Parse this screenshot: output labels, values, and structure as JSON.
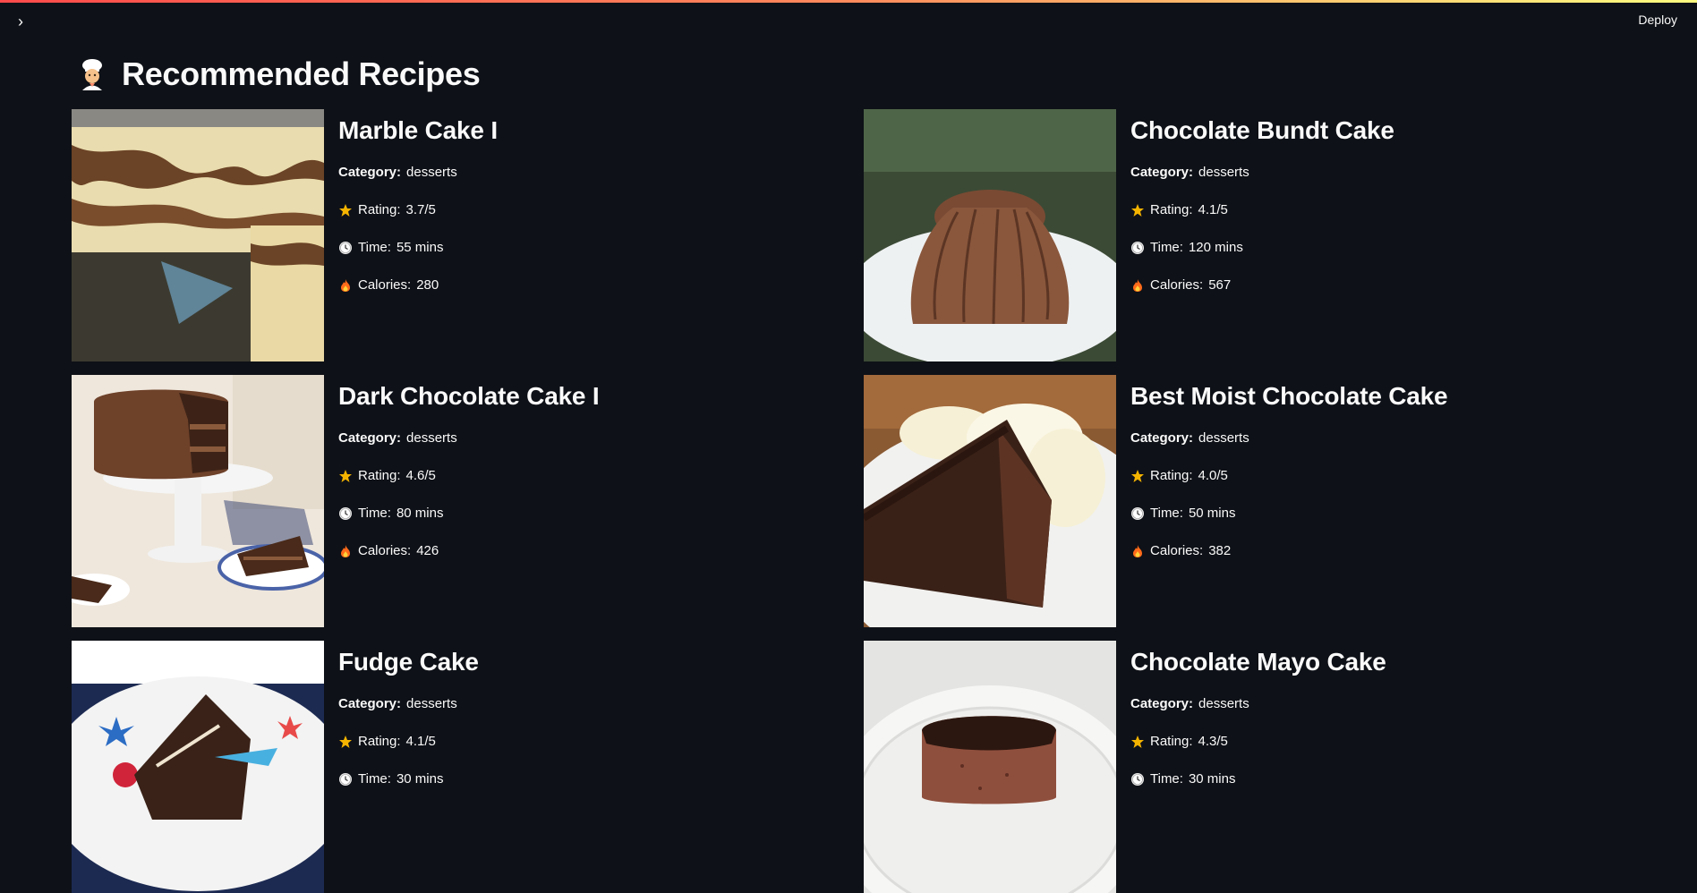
{
  "header": {
    "deploy_label": "Deploy",
    "sidebar_toggle_glyph": "›"
  },
  "page": {
    "title": "Recommended Recipes",
    "title_icon": "chef-icon"
  },
  "labels": {
    "category": "Category:",
    "rating_prefix": "Rating:",
    "time_prefix": "Time:",
    "calories_prefix": "Calories:"
  },
  "icons": {
    "rating": "star-icon",
    "time": "clock-icon",
    "calories": "fire-icon"
  },
  "colors": {
    "background": "#0e1117",
    "text": "#fafafa",
    "star": "#f5b400",
    "flame": "#ff6a1a"
  },
  "recipes": [
    {
      "title": "Marble Cake I",
      "category": "desserts",
      "rating": "3.7/5",
      "time": "55 mins",
      "calories": "280",
      "image": "marble-cake-photo"
    },
    {
      "title": "Chocolate Bundt Cake",
      "category": "desserts",
      "rating": "4.1/5",
      "time": "120 mins",
      "calories": "567",
      "image": "bundt-cake-photo"
    },
    {
      "title": "Dark Chocolate Cake I",
      "category": "desserts",
      "rating": "4.6/5",
      "time": "80 mins",
      "calories": "426",
      "image": "layer-cake-photo"
    },
    {
      "title": "Best Moist Chocolate Cake",
      "category": "desserts",
      "rating": "4.0/5",
      "time": "50 mins",
      "calories": "382",
      "image": "cake-slice-ice-cream-photo"
    },
    {
      "title": "Fudge Cake",
      "category": "desserts",
      "rating": "4.1/5",
      "time": "30 mins",
      "calories": "",
      "image": "fudge-cake-photo"
    },
    {
      "title": "Chocolate Mayo Cake",
      "category": "desserts",
      "rating": "4.3/5",
      "time": "30 mins",
      "calories": "",
      "image": "mayo-cake-photo"
    }
  ]
}
